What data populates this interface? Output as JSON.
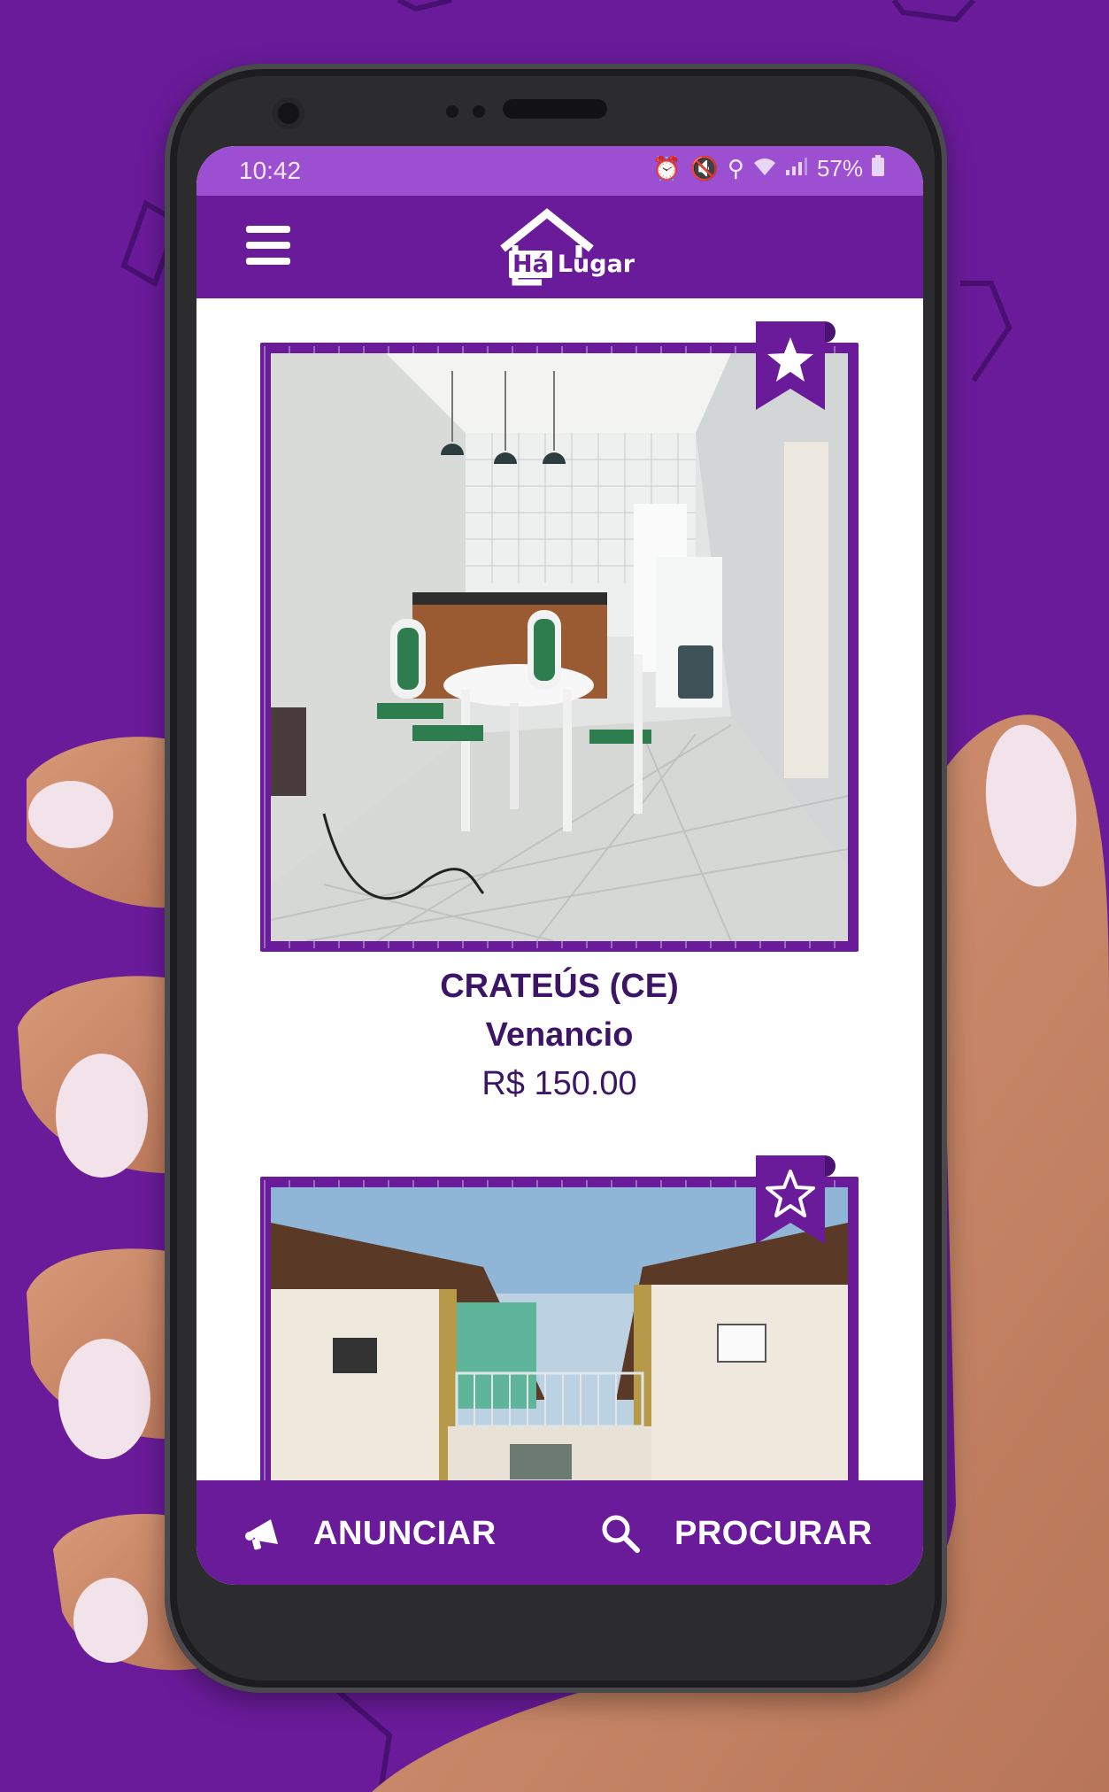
{
  "status_bar": {
    "time": "10:42",
    "battery": "57%",
    "icons": [
      "alarm-icon",
      "mute-icon",
      "location-icon",
      "wifi-icon",
      "signal-icon",
      "battery-icon"
    ]
  },
  "app_bar": {
    "menu_icon": "hamburger-menu-icon",
    "logo_text_a": "Há",
    "logo_text_b": "Lugar"
  },
  "listings": [
    {
      "city": "CRATEÚS (CE)",
      "name": "Venancio",
      "price": "R$ 150.00",
      "favorite": true,
      "photo": "kitchen-dining-room-photo"
    },
    {
      "city": "",
      "name": "",
      "price": "",
      "favorite": false,
      "photo": "building-exterior-photo"
    }
  ],
  "bottom_nav": {
    "announce_label": "ANUNCIAR",
    "announce_icon": "megaphone-icon",
    "search_label": "PROCURAR",
    "search_icon": "magnifier-icon"
  },
  "colors": {
    "brand_purple": "#6a1b9a",
    "status_bar": "#9c4fd1",
    "text_dark_purple": "#3d1566"
  }
}
